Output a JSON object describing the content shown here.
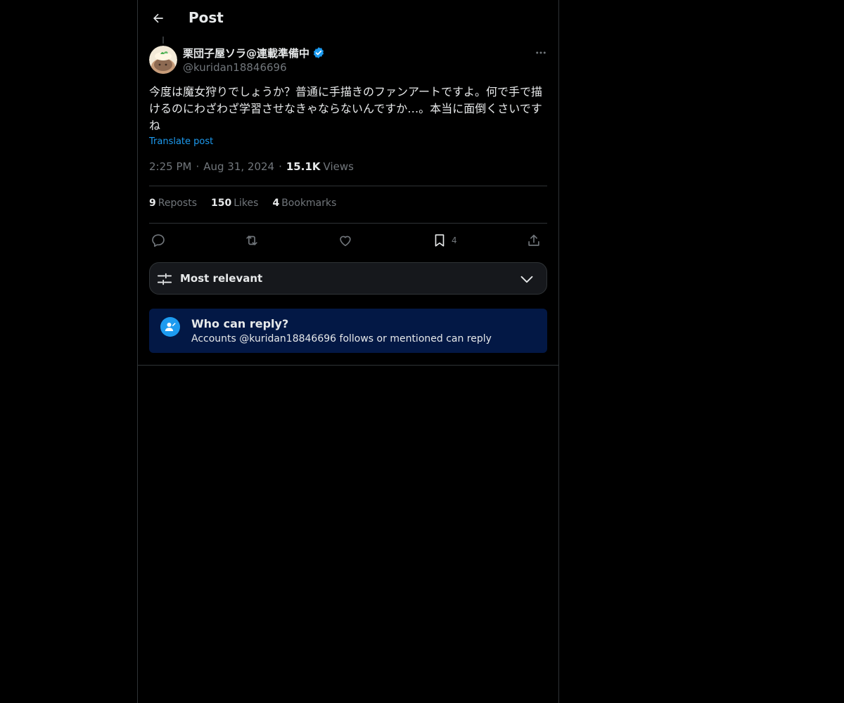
{
  "header": {
    "title": "Post"
  },
  "post": {
    "display_name": "栗団子屋ソラ@連載準備中",
    "handle": "@kuridan18846696",
    "text": "今度は魔女狩りでしょうか？普通に手描きのファンアートですよ。何で手で描けるのにわざわざ学習させなきゃならないんですか…。本当に面倒くさいですね",
    "translate_label": "Translate post",
    "time": "2:25 PM",
    "date": "Aug 31, 2024",
    "views_count": "15.1K",
    "views_label": "Views",
    "meta_separator": "·"
  },
  "stats": {
    "reposts": {
      "count": "9",
      "label": "Reposts"
    },
    "likes": {
      "count": "150",
      "label": "Likes"
    },
    "bookmarks": {
      "count": "4",
      "label": "Bookmarks"
    }
  },
  "actions": {
    "reply": {
      "icon": "reply-icon"
    },
    "repost": {
      "icon": "repost-icon"
    },
    "like": {
      "icon": "heart-icon"
    },
    "bookmark": {
      "icon": "bookmark-icon",
      "count": "4"
    },
    "share": {
      "icon": "share-icon"
    }
  },
  "sort": {
    "label": "Most relevant"
  },
  "reply_restriction": {
    "title": "Who can reply?",
    "description": "Accounts @kuridan18846696 follows or mentioned can reply"
  },
  "colors": {
    "accent": "#1d9bf0",
    "background": "#000000",
    "text": "#e7e9ea",
    "muted": "#71767b",
    "border": "#2f3336",
    "reply_box": "#031845"
  }
}
